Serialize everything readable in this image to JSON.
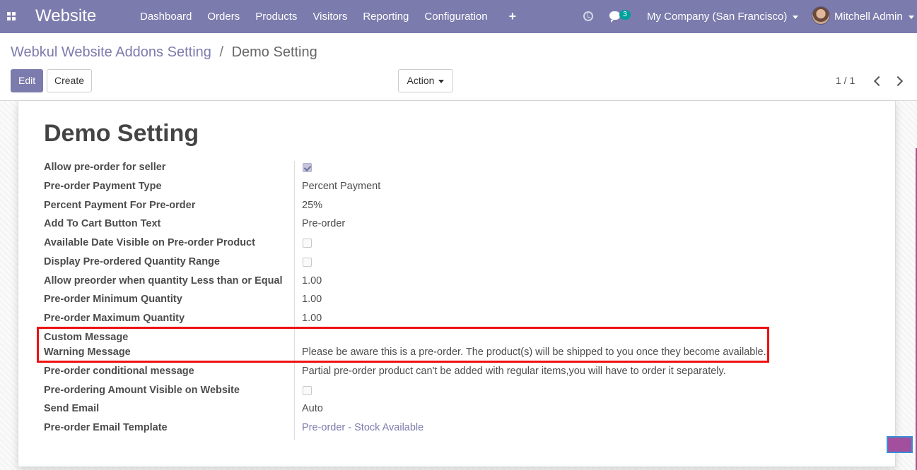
{
  "navbar": {
    "brand": "Website",
    "menu": [
      "Dashboard",
      "Orders",
      "Products",
      "Visitors",
      "Reporting",
      "Configuration"
    ],
    "plus": "+",
    "chat_count": "3",
    "company": "My Company (San Francisco)",
    "user": "Mitchell Admin"
  },
  "breadcrumb": {
    "parent": "Webkul Website Addons Setting",
    "separator": "/",
    "current": "Demo Setting"
  },
  "buttons": {
    "edit": "Edit",
    "create": "Create",
    "action": "Action"
  },
  "pager": {
    "value": "1 / 1"
  },
  "form": {
    "title": "Demo Setting",
    "fields": [
      {
        "label": "Allow pre-order for seller",
        "type": "checkbox",
        "checked": true,
        "value": ""
      },
      {
        "label": "Pre-order Payment Type",
        "type": "text",
        "value": "Percent Payment"
      },
      {
        "label": "Percent Payment For Pre-order",
        "type": "text",
        "value": "25%"
      },
      {
        "label": "Add To Cart Button Text",
        "type": "text",
        "value": "Pre-order"
      },
      {
        "label": "Available Date Visible on Pre-order Product",
        "type": "checkbox",
        "checked": false,
        "value": ""
      },
      {
        "label": "Display Pre-ordered Quantity Range",
        "type": "checkbox",
        "checked": false,
        "value": ""
      },
      {
        "label": "Allow preorder when quantity Less than or Equal",
        "type": "text",
        "value": "1.00"
      },
      {
        "label": "Pre-order Minimum Quantity",
        "type": "text",
        "value": "1.00"
      },
      {
        "label": "Pre-order Maximum Quantity",
        "type": "text",
        "value": "1.00"
      },
      {
        "label": "Custom Message",
        "type": "text",
        "value": ""
      },
      {
        "label": "Warning Message",
        "type": "text",
        "value": "Please be aware this is a pre-order. The product(s) will be shipped to you once they become available."
      },
      {
        "label": "Pre-order conditional message",
        "type": "text",
        "value": "Partial pre-order product can't be added with regular items,you will have to order it separately."
      },
      {
        "label": "Pre-ordering Amount Visible on Website",
        "type": "checkbox",
        "checked": false,
        "value": ""
      },
      {
        "label": "Send Email",
        "type": "text",
        "value": "Auto"
      },
      {
        "label": "Pre-order Email Template",
        "type": "link",
        "value": "Pre-order - Stock Available"
      }
    ]
  },
  "colors": {
    "brand": "#7c7bad",
    "highlight": "#ee1111",
    "badge": "#00a09d"
  }
}
